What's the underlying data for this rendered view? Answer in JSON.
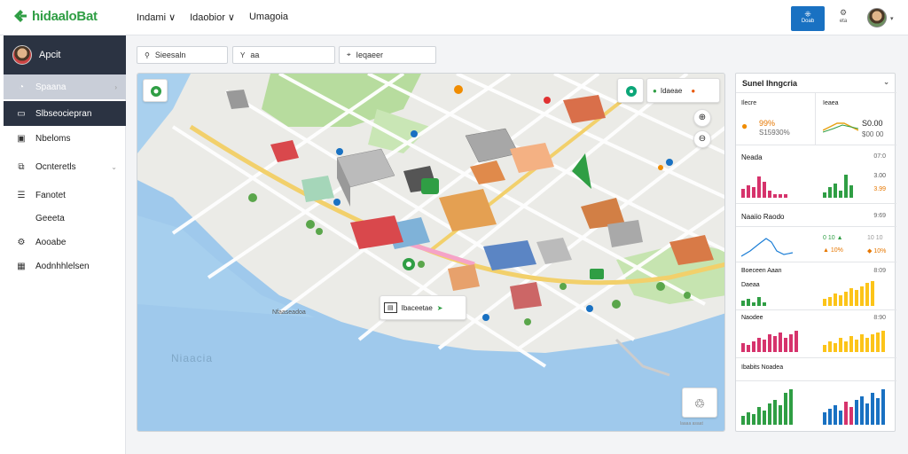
{
  "app": {
    "logo": "hidaaloBat",
    "logo_sub": ""
  },
  "topnav": [
    {
      "label": "Indami ∨"
    },
    {
      "label": "Idaobior ∨"
    },
    {
      "label": "Umagoia"
    }
  ],
  "header_actions": {
    "blue_button_label": "Doab",
    "mini_button_label": "eta"
  },
  "sidebar": {
    "user": "Apcit",
    "items": [
      {
        "label": "Spaana",
        "icon": "gauge-icon",
        "state": "active",
        "chevron": true
      },
      {
        "label": "Slbseociepran",
        "icon": "chat-icon",
        "state": "dark",
        "chevron": false
      },
      {
        "label": "Nbeloms",
        "icon": "image-icon",
        "state": "",
        "chevron": false
      },
      {
        "label": "Ocnteretls",
        "icon": "layers-icon",
        "state": "",
        "chevron": true
      },
      {
        "label": "Fanotet",
        "icon": "sliders-icon",
        "state": "",
        "chevron": false
      },
      {
        "label": "Geeeta",
        "icon": "",
        "state": "",
        "chevron": false
      },
      {
        "label": "Aooabe",
        "icon": "settings-icon",
        "state": "",
        "chevron": false
      },
      {
        "label": "Aodnhhlelsen",
        "icon": "grid-icon",
        "state": "",
        "chevron": false
      }
    ]
  },
  "filters": [
    {
      "label": "Sieesaln",
      "icon": "search-icon"
    },
    {
      "label": "aa",
      "icon": "filter-icon"
    },
    {
      "label": "Ieqaeer",
      "icon": "pin-icon"
    }
  ],
  "map": {
    "legend_label": "Idaeae",
    "tooltip_label": "Ibaceetae",
    "district_label": "Nfaaseadoa",
    "water_label": "Niaacia",
    "attribution": "laaaa asaat"
  },
  "panel": {
    "title": "Sunel Ihngcria",
    "metrics": {
      "name_a": "Ilecre",
      "name_b": "Ieaea",
      "pct_a": "99%",
      "sub_a": "S15930%",
      "val_b": "S0.00",
      "sub_b": "$00 00"
    },
    "sections": [
      {
        "title": "Neada",
        "value": "07:0",
        "value2": "3.00",
        "value3": "3.99"
      },
      {
        "title": "Naaiio Raodo",
        "value": "9:69",
        "row1a": "0 10 ▲",
        "row1b": "10 10",
        "row2a": "▲ 10%",
        "row2b": "◆ 10%"
      },
      {
        "title": "Boeceen Aaan",
        "value": "8:09",
        "title2": "Daeaa"
      },
      {
        "title": "Naodee",
        "value": "8:90"
      },
      {
        "title": "Ibabits Noadea",
        "value": ""
      }
    ]
  },
  "colors": {
    "accent": "#1971c2",
    "green": "#2f9e44",
    "pink": "#d6336c",
    "yellow": "#fcc419",
    "blue": "#1971c2",
    "sidebar_dark": "#2b3342"
  }
}
